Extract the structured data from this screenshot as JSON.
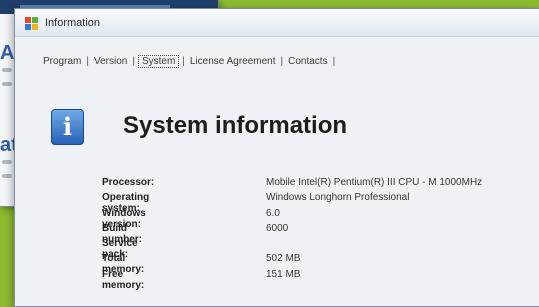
{
  "window": {
    "title": "Information"
  },
  "tabs": [
    {
      "label": "Program",
      "active": false
    },
    {
      "label": "Version",
      "active": false
    },
    {
      "label": "System",
      "active": true
    },
    {
      "label": "License Agreement",
      "active": false
    },
    {
      "label": "Contacts",
      "active": false
    }
  ],
  "page": {
    "heading": "System information",
    "icon": "info-icon"
  },
  "properties": [
    {
      "label": "Processor:",
      "value": "Mobile Intel(R) Pentium(R) III CPU - M 1000MHz"
    },
    {
      "label": "Operating system:",
      "value": "Windows Longhorn Professional"
    },
    {
      "label": "Windows version:",
      "value": "6.0"
    },
    {
      "label": "Build number:",
      "value": "6000"
    },
    {
      "label": "Service pack:",
      "value": ""
    },
    {
      "label": "Total memory:",
      "value": "502 MB"
    },
    {
      "label": "Free memory:",
      "value": "151 MB"
    }
  ],
  "background_window": {
    "heading_1": "A",
    "heading_2": "at"
  },
  "colors": {
    "accent": "#2f5ea9",
    "background": "#8dbb30"
  }
}
